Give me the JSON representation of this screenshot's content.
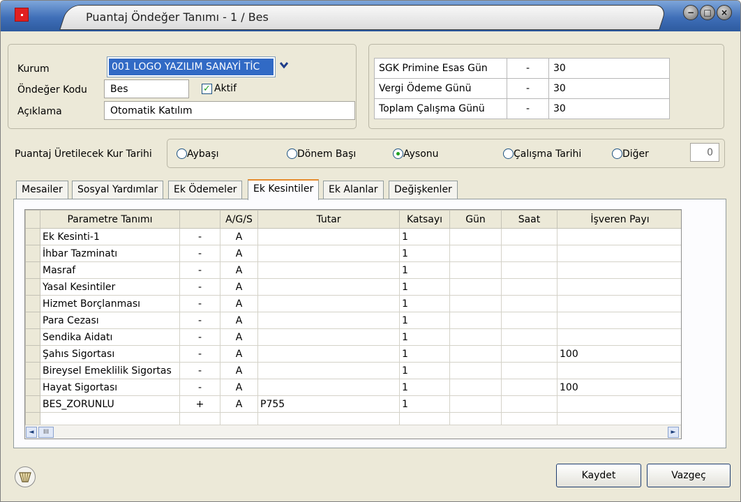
{
  "window": {
    "title": "Puantaj Öndeğer Tanımı - 1 / Bes",
    "controls": {
      "minimize": "−",
      "maximize": "□",
      "close": "×"
    }
  },
  "header": {
    "kurum_label": "Kurum",
    "kurum_value": "001 LOGO YAZILIM SANAYİ TİC",
    "ondeger_kodu_label": "Öndeğer Kodu",
    "ondeger_kodu_value": "Bes",
    "aktif_label": "Aktif",
    "aktif_checked": true,
    "aciklama_label": "Açıklama",
    "aciklama_value": "Otomatik Katılım"
  },
  "sgk": [
    {
      "label": "SGK Primine Esas Gün",
      "sep": "-",
      "value": "30"
    },
    {
      "label": "Vergi Ödeme Günü",
      "sep": "-",
      "value": "30"
    },
    {
      "label": "Toplam Çalışma Günü",
      "sep": "-",
      "value": "30"
    }
  ],
  "kur": {
    "label": "Puantaj Üretilecek Kur Tarihi",
    "options": [
      "Aybaşı",
      "Dönem Başı",
      "Aysonu",
      "Çalışma Tarihi",
      "Diğer"
    ],
    "selected": "Aysonu",
    "diger_value": "0"
  },
  "tabs": [
    "Mesailer",
    "Sosyal Yardımlar",
    "Ek Ödemeler",
    "Ek Kesintiler",
    "Ek Alanlar",
    "Değişkenler"
  ],
  "active_tab": "Ek Kesintiler",
  "grid": {
    "columns": [
      "Parametre Tanımı",
      "",
      "A/G/S",
      "Tutar",
      "Katsayı",
      "Gün",
      "Saat",
      "İşveren Payı"
    ],
    "rows": [
      [
        "Ek Kesinti-1",
        "-",
        "A",
        "",
        "1",
        "",
        "",
        ""
      ],
      [
        "İhbar Tazminatı",
        "-",
        "A",
        "",
        "1",
        "",
        "",
        ""
      ],
      [
        "Masraf",
        "-",
        "A",
        "",
        "1",
        "",
        "",
        ""
      ],
      [
        "Yasal Kesintiler",
        "-",
        "A",
        "",
        "1",
        "",
        "",
        ""
      ],
      [
        "Hizmet Borçlanması",
        "-",
        "A",
        "",
        "1",
        "",
        "",
        ""
      ],
      [
        "Para Cezası",
        "-",
        "A",
        "",
        "1",
        "",
        "",
        ""
      ],
      [
        "Sendika Aidatı",
        "-",
        "A",
        "",
        "1",
        "",
        "",
        ""
      ],
      [
        "Şahıs Sigortası",
        "-",
        "A",
        "",
        "1",
        "",
        "",
        "100"
      ],
      [
        "Bireysel Emeklilik Sigortas",
        "-",
        "A",
        "",
        "1",
        "",
        "",
        ""
      ],
      [
        "Hayat Sigortası",
        "-",
        "A",
        "",
        "1",
        "",
        "",
        "100"
      ],
      [
        "BES_ZORUNLU",
        "+",
        "A",
        "P755",
        "1",
        "",
        "",
        ""
      ]
    ],
    "scroll": {
      "left": "◄",
      "right": "►",
      "thumb": "III"
    }
  },
  "buttons": {
    "kaydet": "Kaydet",
    "vazgec": "Vazgeç"
  }
}
